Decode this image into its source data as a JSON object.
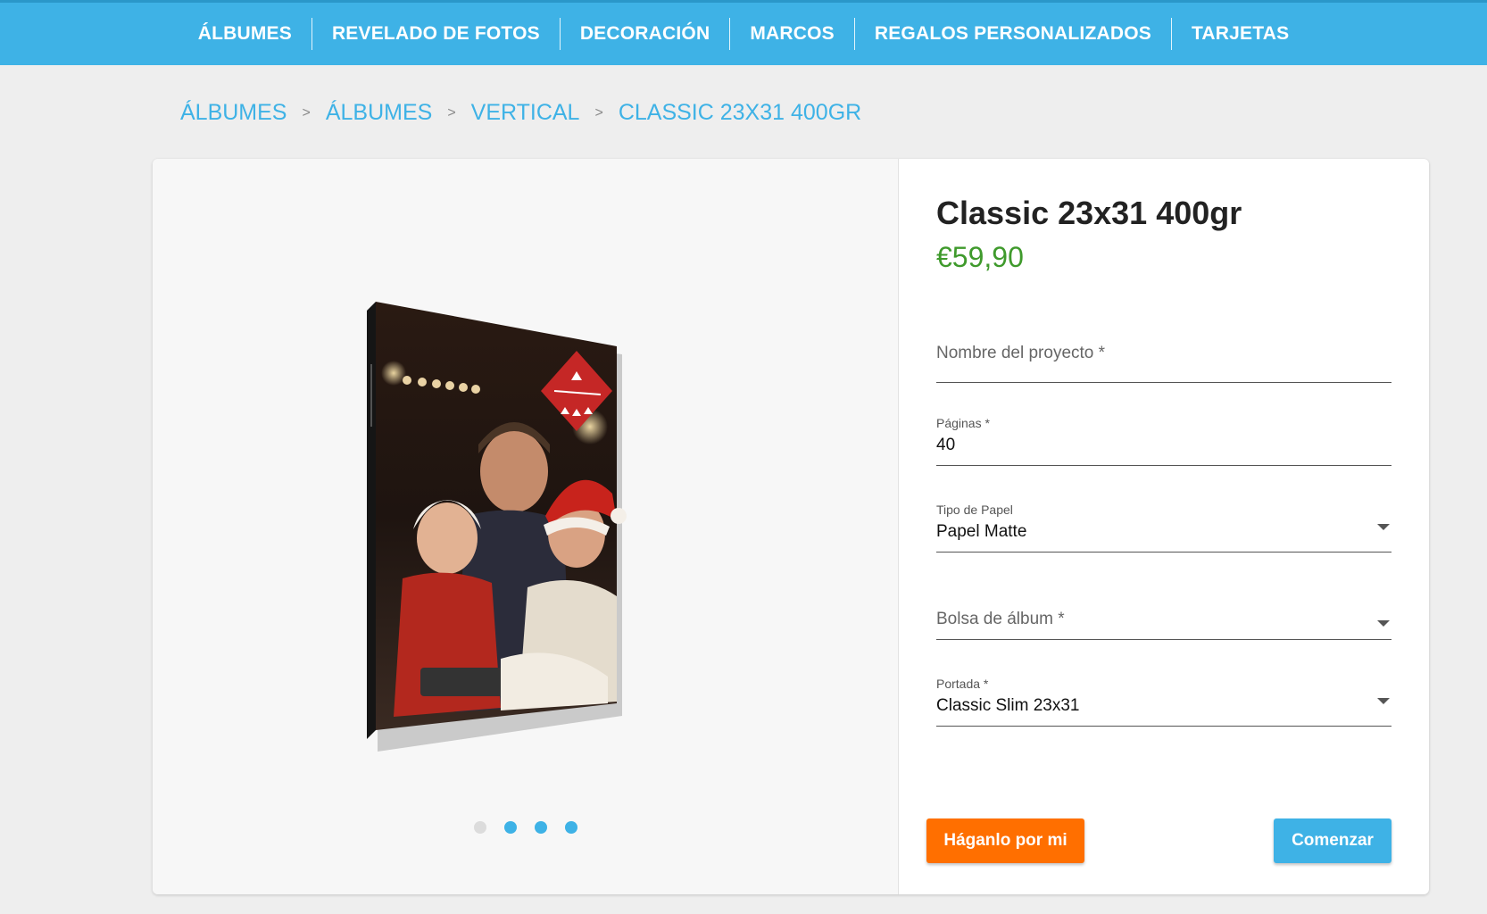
{
  "nav": {
    "items": [
      {
        "label": "ÁLBUMES"
      },
      {
        "label": "REVELADO DE FOTOS"
      },
      {
        "label": "DECORACIÓN"
      },
      {
        "label": "MARCOS"
      },
      {
        "label": "REGALOS PERSONALIZADOS"
      },
      {
        "label": "TARJETAS"
      }
    ]
  },
  "breadcrumb": {
    "items": [
      "ÁLBUMES",
      "ÁLBUMES",
      "VERTICAL",
      "CLASSIC 23X31 400GR"
    ],
    "separator": ">"
  },
  "gallery": {
    "slides_total": 4,
    "active_slide": 1
  },
  "product": {
    "title": "Classic 23x31 400gr",
    "price": "€59,90"
  },
  "form": {
    "project_name": {
      "placeholder": "Nombre del proyecto *"
    },
    "pages": {
      "label": "Páginas *",
      "value": "40"
    },
    "paper_type": {
      "label": "Tipo de Papel",
      "value": "Papel Matte"
    },
    "album_bag": {
      "placeholder": "Bolsa de álbum *"
    },
    "cover": {
      "label": "Portada *",
      "value": "Classic Slim 23x31"
    }
  },
  "buttons": {
    "do_it_for_me": "Háganlo por mi",
    "start": "Comenzar"
  },
  "colors": {
    "accent": "#3eb2e6",
    "price": "#3f9a2c",
    "orange_button": "#ff6f00"
  }
}
